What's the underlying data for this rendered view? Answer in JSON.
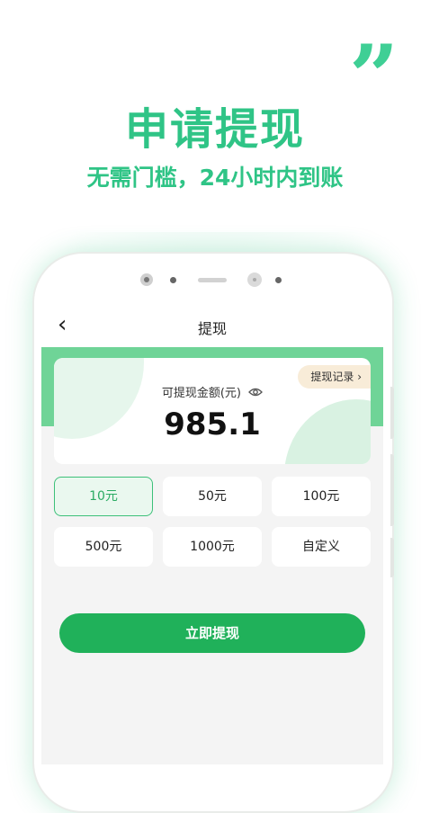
{
  "promo": {
    "quote_mark": "”",
    "headline": "申请提现",
    "subline": "无需门槛，24小时内到账"
  },
  "appbar": {
    "back_icon": "chevron-left-icon",
    "back_glyph": "‹",
    "title": "提现"
  },
  "balance": {
    "label": "可提现金额(元)",
    "visibility_icon": "eye-icon",
    "amount": "985.1",
    "record_button": "提现记录 ›"
  },
  "options": [
    {
      "label": "10元",
      "selected": true
    },
    {
      "label": "50元",
      "selected": false
    },
    {
      "label": "100元",
      "selected": false
    },
    {
      "label": "500元",
      "selected": false
    },
    {
      "label": "1000元",
      "selected": false
    },
    {
      "label": "自定义",
      "selected": false
    }
  ],
  "submit": {
    "label": "立即提现"
  },
  "colors": {
    "brand_green": "#2fc486",
    "button_green": "#20b15a",
    "band_green": "#6fd497",
    "record_bg": "#f8ecd8"
  }
}
